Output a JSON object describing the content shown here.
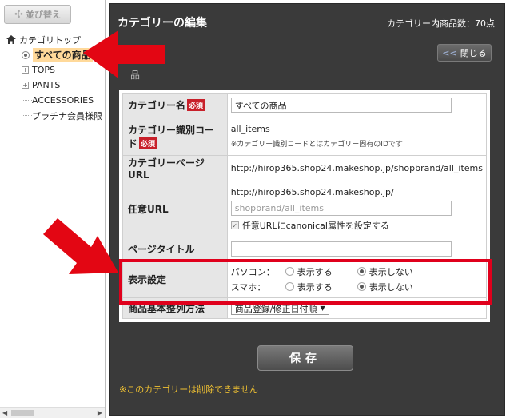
{
  "left": {
    "sort_label": "並び替え",
    "tree": {
      "root": "カテゴリトップ",
      "selected": "すべての商品",
      "items": [
        "TOPS",
        "PANTS",
        "ACCESSORIES",
        "プラチナ会員様限"
      ]
    }
  },
  "panel": {
    "title": "カテゴリーの編集",
    "count": "カテゴリー内商品数：70点",
    "close_label": "閉じる",
    "close_chevron": "<<",
    "section_label": "品",
    "save_label": "保存",
    "warning": "※このカテゴリーは削除できません"
  },
  "form": {
    "required_badge": "必須",
    "name": {
      "label": "カテゴリー名",
      "value": "すべての商品"
    },
    "code": {
      "label": "カテゴリー識別コード",
      "value": "all_items",
      "note": "※カテゴリー識別コードとはカテゴリー固有のIDです"
    },
    "page_url": {
      "label": "カテゴリーページURL",
      "value": "http://hirop365.shop24.makeshop.jp/shopbrand/all_items"
    },
    "optional_url": {
      "label": "任意URL",
      "prefix": "http://hirop365.shop24.makeshop.jp/",
      "input_value": "shopbrand/all_items",
      "canonical_label": "任意URLにcanonical属性を設定する",
      "canonical_checked": true
    },
    "page_title": {
      "label": "ページタイトル",
      "value": ""
    },
    "display": {
      "label": "表示設定",
      "pc_label": "パソコン：",
      "sp_label": "スマホ：",
      "show": "表示する",
      "hide": "表示しない",
      "pc_value": "表示しない",
      "sp_value": "表示しない"
    },
    "sort": {
      "label": "商品基本整列方法",
      "value": "商品登録/修正日付順"
    }
  },
  "colors": {
    "panel_bg": "#3a3a3a",
    "highlight": "#e0001c",
    "required": "#c8202a",
    "warning": "#f1c232",
    "selected_bg": "#ffd99a"
  }
}
